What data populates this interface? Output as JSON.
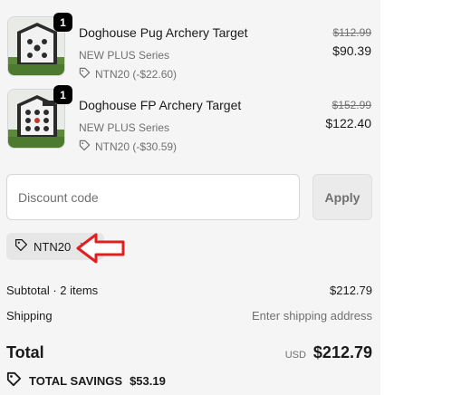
{
  "line_items": [
    {
      "title": "Doghouse Pug Archery Target",
      "variant": "NEW PLUS Series",
      "discount": "NTN20 (-$22.60)",
      "original_price": "$112.99",
      "price": "$90.39",
      "quantity": "1"
    },
    {
      "title": "Doghouse FP Archery Target",
      "variant": "NEW PLUS Series",
      "discount": "NTN20 (-$30.59)",
      "original_price": "$152.99",
      "price": "$122.40",
      "quantity": "1"
    }
  ],
  "discount": {
    "placeholder": "Discount code",
    "apply_label": "Apply",
    "applied_code": "NTN20"
  },
  "summary": {
    "subtotal_label": "Subtotal · 2 items",
    "subtotal_value": "$212.79",
    "shipping_label": "Shipping",
    "shipping_value": "Enter shipping address",
    "total_label": "Total",
    "currency": "USD",
    "total_value": "$212.79",
    "savings_label": "TOTAL SAVINGS",
    "savings_value": "$53.19"
  },
  "colors": {
    "panel_bg": "#f5f5f5",
    "annotation_arrow": "#e02020",
    "badge": "#000000"
  },
  "icons": {
    "tag": "tag-icon",
    "remove": "close-icon",
    "annotation": "red-arrow-icon"
  }
}
